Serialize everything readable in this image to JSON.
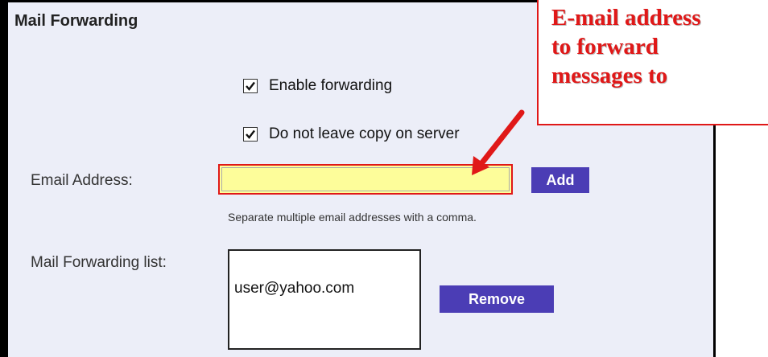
{
  "panel": {
    "title": "Mail Forwarding",
    "enable_forwarding": {
      "label": "Enable forwarding",
      "checked": true
    },
    "no_copy": {
      "label": "Do not leave copy on server",
      "checked": true
    },
    "email_label": "Email Address:",
    "email_value": "",
    "add_label": "Add",
    "hint": "Separate multiple email addresses with a comma.",
    "list_label": "Mail Forwarding list:",
    "list_items": [
      "user@yahoo.com"
    ],
    "remove_label": "Remove"
  },
  "callout": {
    "text": "E-mail address\nto forward\nmessages to"
  },
  "colors": {
    "accent_red": "#e01818",
    "button_purple": "#4b3db5",
    "panel_bg": "#eceef8",
    "highlight_yellow": "#ffff99"
  }
}
